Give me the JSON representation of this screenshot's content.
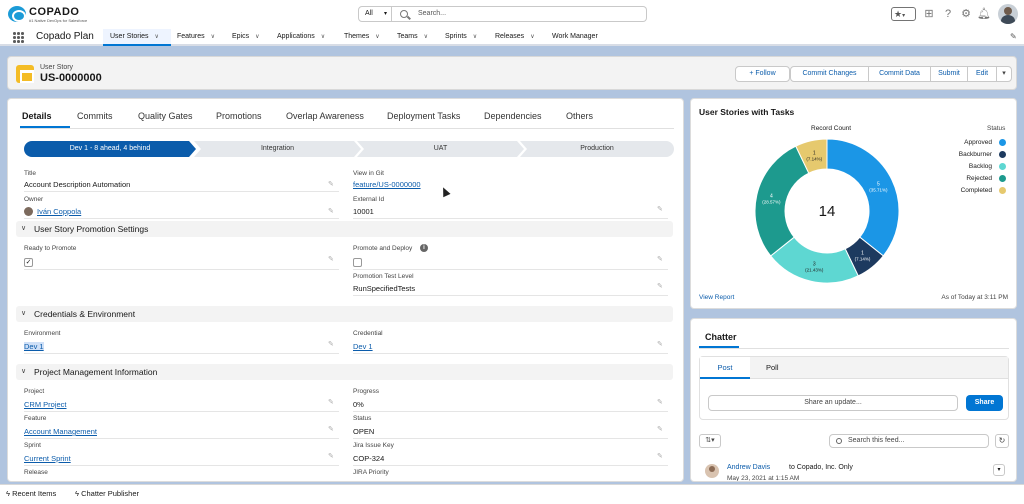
{
  "brand": {
    "name": "COPADO",
    "tagline": "#1 Native DevOps for Salesforce"
  },
  "search": {
    "scope": "All",
    "placeholder": "Search..."
  },
  "app": {
    "name": "Copado Plan",
    "tabs": [
      {
        "label": "User Stories",
        "active": true
      },
      {
        "label": "Features"
      },
      {
        "label": "Epics"
      },
      {
        "label": "Applications"
      },
      {
        "label": "Themes"
      },
      {
        "label": "Teams"
      },
      {
        "label": "Sprints"
      },
      {
        "label": "Releases"
      },
      {
        "label": "Work Manager"
      }
    ]
  },
  "record": {
    "type": "User Story",
    "id": "US-0000000",
    "actions": [
      "+ Follow",
      "Commit Changes",
      "Commit Data",
      "Submit",
      "Edit"
    ]
  },
  "detail_tabs": [
    "Details",
    "Commits",
    "Quality Gates",
    "Promotions",
    "Overlap Awareness",
    "Deployment Tasks",
    "Dependencies",
    "Others"
  ],
  "path": [
    "Dev 1 - 8 ahead, 4 behind",
    "Integration",
    "UAT",
    "Production"
  ],
  "fields": {
    "title": {
      "label": "Title",
      "value": "Account Description Automation"
    },
    "view_in_git": {
      "label": "View in Git",
      "value": "feature/US-0000000"
    },
    "owner": {
      "label": "Owner",
      "value": "Iván Coppola"
    },
    "external_id": {
      "label": "External Id",
      "value": "10001"
    },
    "ready_to_promote": {
      "label": "Ready to Promote",
      "checked": true
    },
    "promote_and_deploy": {
      "label": "Promote and Deploy",
      "checked": false
    },
    "promotion_test_level": {
      "label": "Promotion Test Level",
      "value": "RunSpecifiedTests"
    },
    "environment": {
      "label": "Environment",
      "value": "Dev 1"
    },
    "credential": {
      "label": "Credential",
      "value": "Dev 1"
    },
    "project": {
      "label": "Project",
      "value": "CRM Project"
    },
    "progress": {
      "label": "Progress",
      "value": "0%"
    },
    "feature": {
      "label": "Feature",
      "value": "Account Management"
    },
    "status": {
      "label": "Status",
      "value": "OPEN"
    },
    "sprint": {
      "label": "Sprint",
      "value": "Current Sprint"
    },
    "jira_key": {
      "label": "Jira Issue Key",
      "value": "COP-324"
    },
    "release": {
      "label": "Release",
      "value": ""
    },
    "jira_priority": {
      "label": "JIRA Priority",
      "value": ""
    }
  },
  "sections": {
    "promotion": "User Story Promotion Settings",
    "credentials": "Credentials & Environment",
    "project_mgmt": "Project Management Information"
  },
  "chart_card": {
    "title": "User Stories with Tasks",
    "measure_label": "Record Count",
    "legend_title": "Status",
    "total": "14",
    "view_report": "View Report",
    "as_of": "As of Today at 3:11 PM"
  },
  "chart_data": {
    "type": "pie",
    "title": "User Stories with Tasks",
    "legend": "right",
    "series": [
      {
        "name": "Approved",
        "value": 5,
        "label": "5",
        "pct": "(35.71%)",
        "color": "#1b96e6"
      },
      {
        "name": "Backburner",
        "value": 1,
        "label": "1",
        "pct": "(7.14%)",
        "color": "#1d3a5f"
      },
      {
        "name": "Backlog",
        "value": 3,
        "label": "3",
        "pct": "(21.43%)",
        "color": "#5ed7d2"
      },
      {
        "name": "Rejected",
        "value": 4,
        "label": "4",
        "pct": "(28.57%)",
        "color": "#1d9a8e"
      },
      {
        "name": "Completed",
        "value": 1,
        "label": "1",
        "pct": "(7.14%)",
        "color": "#e6c96e"
      }
    ]
  },
  "chatter": {
    "title": "Chatter",
    "tabs": [
      "Post",
      "Poll"
    ],
    "share_placeholder": "Share an update...",
    "share_button": "Share",
    "search_placeholder": "Search this feed...",
    "post": {
      "author": "Andrew Davis",
      "context": "to Copado, Inc. Only",
      "date": "May 23, 2021 at 1:15 AM"
    }
  },
  "utility_bar": [
    "Recent Items",
    "Chatter Publisher"
  ],
  "colors": {
    "brand": "#0176d3",
    "path_current": "#0b5cab",
    "record_icon": "#f4bc25"
  }
}
